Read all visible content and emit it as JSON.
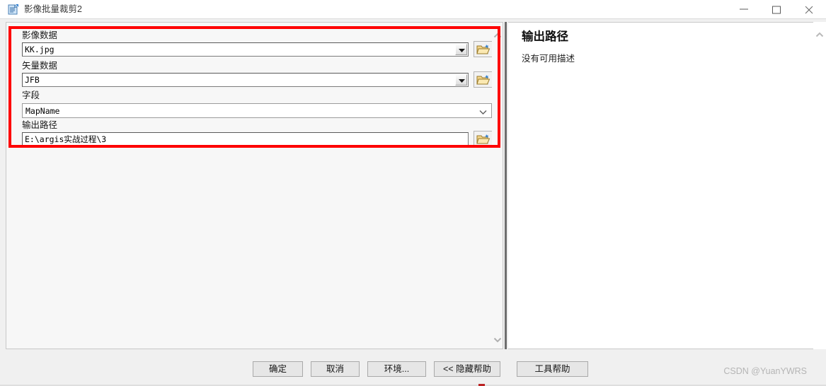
{
  "window": {
    "title": "影像批量裁剪2",
    "icon": "script-tool-icon",
    "controls": {
      "minimize": "minimize-icon",
      "maximize": "maximize-icon",
      "close": "close-icon"
    }
  },
  "form": {
    "fields": [
      {
        "label": "影像数据",
        "value": "KK.jpg",
        "type": "combobox-classic",
        "browse": "open-folder-icon"
      },
      {
        "label": "矢量数据",
        "value": "JFB",
        "type": "combobox-classic",
        "browse": "open-folder-icon"
      },
      {
        "label": "字段",
        "value": "MapName",
        "type": "combobox-modern",
        "browse": null
      },
      {
        "label": "输出路径",
        "value": "E:\\argis实战过程\\3",
        "type": "textbox",
        "browse": "open-folder-icon"
      }
    ]
  },
  "help_panel": {
    "title": "输出路径",
    "description": "没有可用描述"
  },
  "footer": {
    "buttons": [
      {
        "label": "确定",
        "name": "ok-button"
      },
      {
        "label": "取消",
        "name": "cancel-button"
      },
      {
        "label": "环境...",
        "name": "environments-button"
      },
      {
        "label": "<< 隐藏帮助",
        "name": "hide-help-button"
      },
      {
        "label": "工具帮助",
        "name": "tool-help-button"
      }
    ],
    "watermark": "CSDN @YuanYWRS"
  },
  "annotation": {
    "color": "#fe0000",
    "shape": "rectangle-highlight"
  },
  "scrollbars": {
    "left_up": "chevron-up-icon",
    "left_down": "chevron-down-icon",
    "right_up": "chevron-up-icon"
  }
}
